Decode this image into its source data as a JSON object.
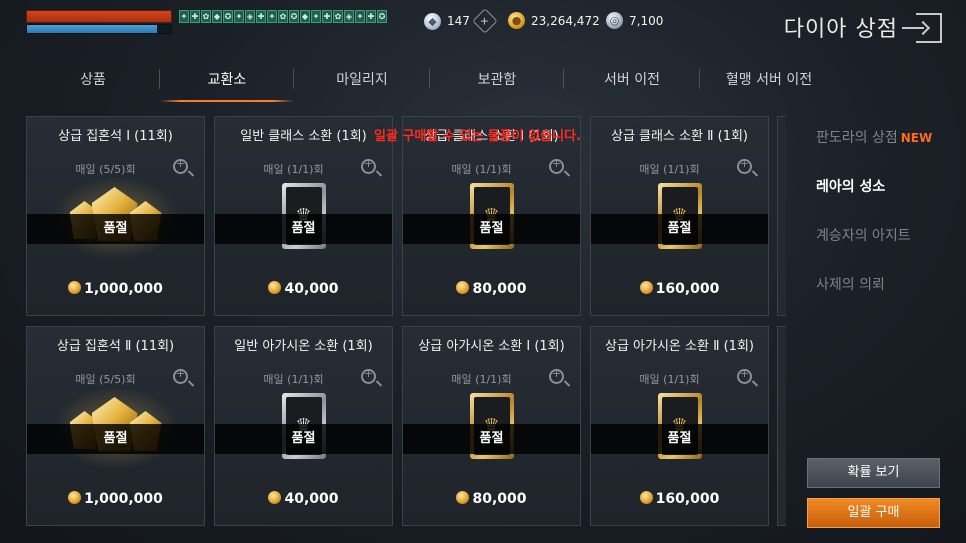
{
  "hud": {
    "hp_fraction": 1.0,
    "mp_fraction": 0.9,
    "buff_icons": [
      "✦",
      "✚",
      "✿",
      "◆",
      "✪",
      "✦",
      "◈",
      "✚",
      "✦",
      "✿",
      "✪",
      "◆",
      "✦",
      "✚",
      "✿",
      "◈",
      "✦",
      "✚",
      "✪"
    ]
  },
  "currencies": {
    "diamond": "147",
    "gold": "23,264,472",
    "silver": "7,100"
  },
  "store_title": "다이아 상점",
  "tabs": [
    {
      "label": "상품"
    },
    {
      "label": "교환소",
      "active": true
    },
    {
      "label": "마일리지"
    },
    {
      "label": "보관함"
    },
    {
      "label": "서버 이전"
    },
    {
      "label": "혈맹 서버 이전"
    }
  ],
  "notice": "일괄 구매할 수 있는 물품이 없습니다.",
  "items": [
    {
      "title": "상급 집혼석 Ⅰ (11회)",
      "limit": "매일 (5/5)회",
      "status": "품절",
      "price": "1,000,000",
      "art": "gems"
    },
    {
      "title": "일반 클래스 소환 (1회)",
      "limit": "매일 (1/1)회",
      "status": "품절",
      "price": "40,000",
      "art": "silver-card"
    },
    {
      "title": "상급 클래스 소환 Ⅰ (1회)",
      "limit": "매일 (1/1)회",
      "status": "품절",
      "price": "80,000",
      "art": "gold-card"
    },
    {
      "title": "상급 클래스 소환 Ⅱ (1회)",
      "limit": "매일 (1/1)회",
      "status": "품절",
      "price": "160,000",
      "art": "gold-card"
    },
    {
      "title": "상급 집혼석 Ⅱ (11회)",
      "limit": "매일 (5/5)회",
      "status": "품절",
      "price": "1,000,000",
      "art": "gems"
    },
    {
      "title": "일반 아가시온 소환 (1회)",
      "limit": "매일 (1/1)회",
      "status": "품절",
      "price": "40,000",
      "art": "silver-card"
    },
    {
      "title": "상급 아가시온 소환 Ⅰ (1회)",
      "limit": "매일 (1/1)회",
      "status": "품절",
      "price": "80,000",
      "art": "gold-card"
    },
    {
      "title": "상급 아가시온 소환 Ⅱ (1회)",
      "limit": "매일 (1/1)회",
      "status": "품절",
      "price": "160,000",
      "art": "gold-card"
    }
  ],
  "side_menu": [
    {
      "label": "판도라의 상점",
      "badge": "NEW"
    },
    {
      "label": "레아의 성소",
      "active": true
    },
    {
      "label": "계승자의 아지트"
    },
    {
      "label": "사제의 의뢰"
    }
  ],
  "buttons": {
    "odds": "확률 보기",
    "bulk_buy": "일괄 구매"
  }
}
